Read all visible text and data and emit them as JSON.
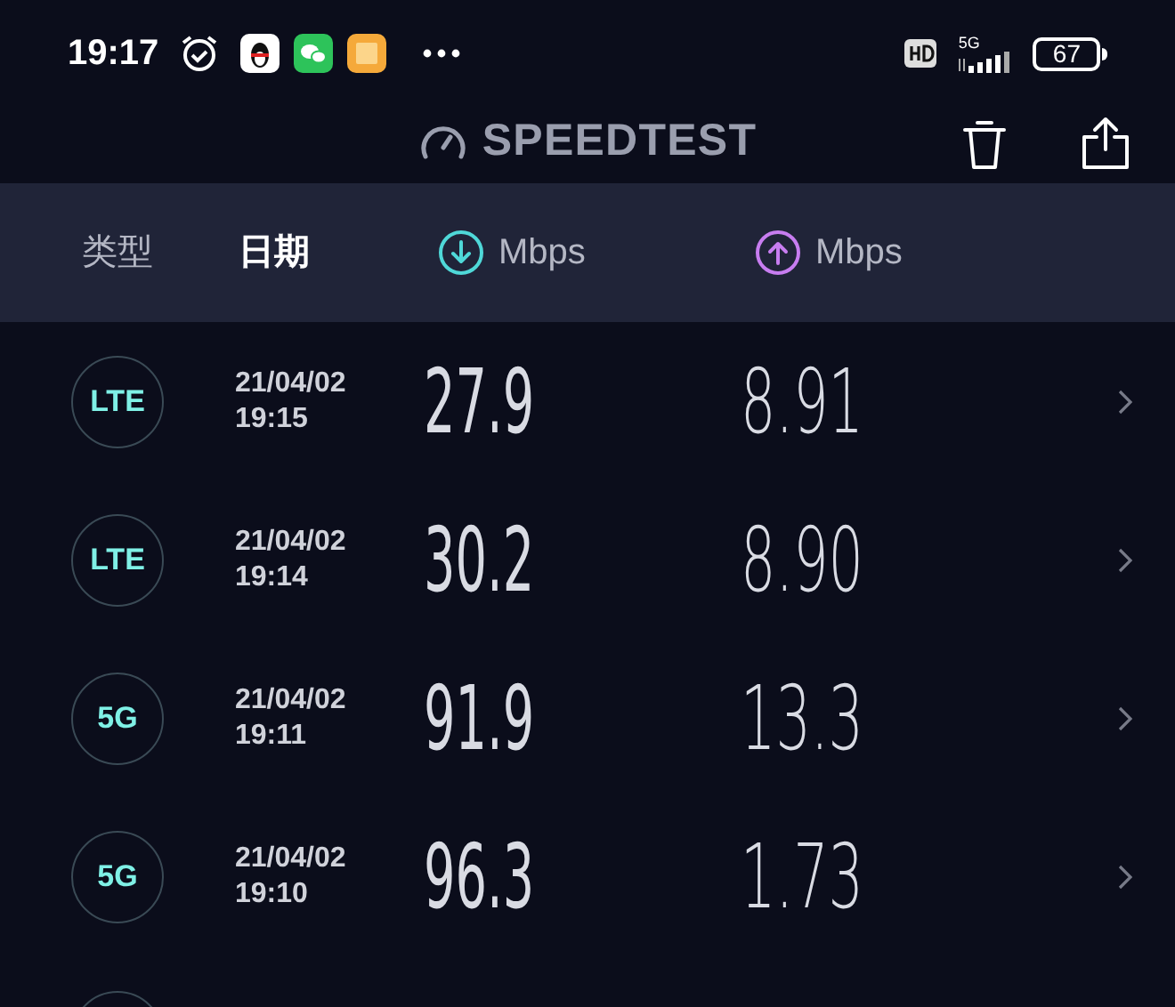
{
  "status_bar": {
    "time": "19:17",
    "network": "5G",
    "battery": "67"
  },
  "title": "SPEEDTEST",
  "columns": [
    {
      "label": "类型",
      "selected": false,
      "kind": "text"
    },
    {
      "label": "日期",
      "selected": true,
      "kind": "text"
    },
    {
      "label": "Mbps",
      "selected": false,
      "kind": "download"
    },
    {
      "label": "Mbps",
      "selected": false,
      "kind": "upload"
    }
  ],
  "rows": [
    {
      "type": "LTE",
      "date": "21/04/02",
      "time": "19:15",
      "download": "27.9",
      "upload": "8.91"
    },
    {
      "type": "LTE",
      "date": "21/04/02",
      "time": "19:14",
      "download": "30.2",
      "upload": "8.90"
    },
    {
      "type": "5G",
      "date": "21/04/02",
      "time": "19:11",
      "download": "91.9",
      "upload": "13.3"
    },
    {
      "type": "5G",
      "date": "21/04/02",
      "time": "19:10",
      "download": "96.3",
      "upload": "1.73"
    }
  ]
}
